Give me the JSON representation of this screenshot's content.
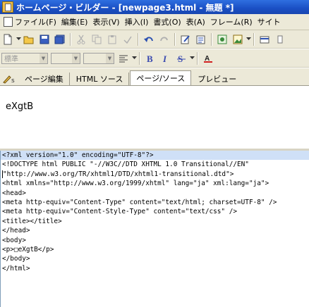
{
  "window": {
    "title": "ホームページ・ビルダー - [newpage3.html - 無題 *]"
  },
  "menu": {
    "items": [
      "ファイル(F)",
      "編集(E)",
      "表示(V)",
      "挿入(I)",
      "書式(O)",
      "表(A)",
      "フレーム(R)",
      "サイト"
    ]
  },
  "toolbar2": {
    "style_combo": "標準"
  },
  "tabs": [
    {
      "label": "ページ編集"
    },
    {
      "label": "HTML ソース"
    },
    {
      "label": "ページ/ソース"
    },
    {
      "label": "プレビュー"
    }
  ],
  "active_tab": "ページ/ソース",
  "preview": {
    "text": "eXgtB"
  },
  "source": {
    "lines": [
      "<?xml version=\"1.0\" encoding=\"UTF-8\"?>",
      "<!DOCTYPE html PUBLIC \"-//W3C//DTD XHTML 1.0 Transitional//EN\"",
      "\"http://www.w3.org/TR/xhtml1/DTD/xhtml1-transitional.dtd\">",
      "<html xmlns=\"http://www.w3.org/1999/xhtml\" lang=\"ja\" xml:lang=\"ja\">",
      "<head>",
      "<meta http-equiv=\"Content-Type\" content=\"text/html; charset=UTF-8\" />",
      "<meta http-equiv=\"Content-Style-Type\" content=\"text/css\" />",
      "<title></title>",
      "</head>",
      "<body>",
      "<p>□eXgtB</p>",
      "</body>",
      "</html>"
    ]
  },
  "colors": {
    "titlebar": "#1a4fc4",
    "chrome": "#ece9d8",
    "selection": "#cfe0f7"
  }
}
